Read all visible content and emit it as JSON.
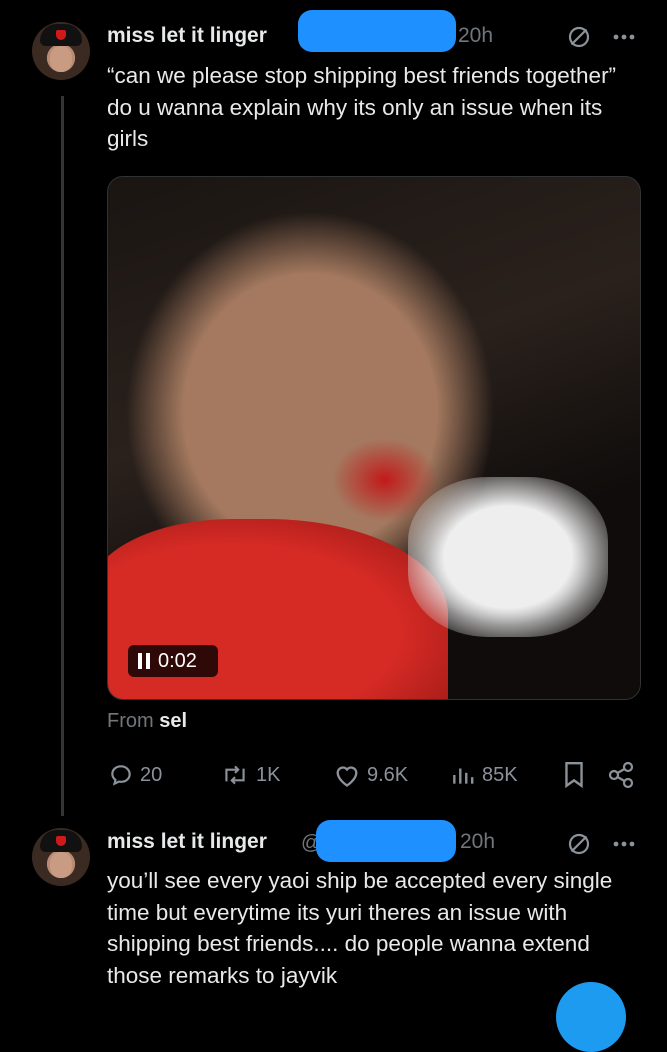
{
  "tweet1": {
    "display_name": "miss let it linger",
    "time": "20h",
    "text": "“can we please stop shipping best friends together” do u wanna explain why its only an issue when its girls",
    "video": {
      "timestamp": "0:02"
    },
    "from_prefix": "From",
    "from_user": "sel",
    "actions": {
      "replies": "20",
      "reposts": "1K",
      "likes": "9.6K",
      "views": "85K"
    }
  },
  "tweet2": {
    "display_name": "miss let it linger",
    "handle": "@",
    "time": "20h",
    "text": "you’ll see every yaoi ship be accepted every single time but everytime its yuri theres an issue with shipping best friends.... do people wanna extend those remarks to jayvik"
  },
  "icons": [
    "more-icon",
    "no-entry-icon",
    "reply-icon",
    "repost-icon",
    "like-icon",
    "views-icon",
    "bookmark-icon",
    "share-icon",
    "pause-icon"
  ],
  "colors": {
    "background": "#000000",
    "text": "#e7e9ea",
    "secondary": "#71767b",
    "redaction": "#1e90ff",
    "accent": "#1d9bf0"
  }
}
